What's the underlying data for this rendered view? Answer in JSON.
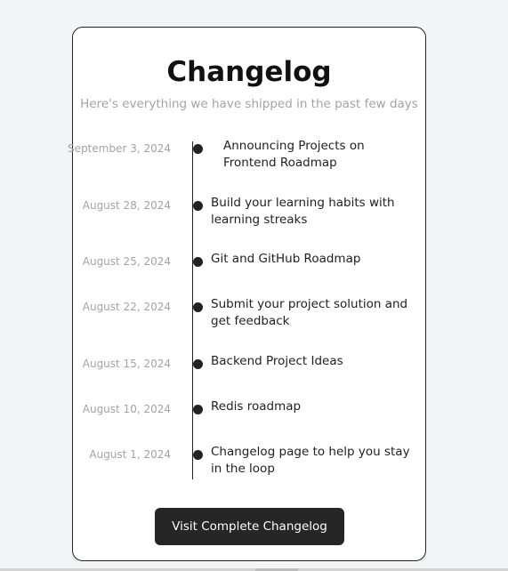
{
  "changelog": {
    "title": "Changelog",
    "subtitle": "Here's everything we have shipped in the past few days",
    "entries": [
      {
        "date": "September 3, 2024",
        "title": "Announcing Projects on Frontend Roadmap"
      },
      {
        "date": "August 28, 2024",
        "title": "Build your learning habits with learning streaks"
      },
      {
        "date": "August 25, 2024",
        "title": "Git and GitHub Roadmap"
      },
      {
        "date": "August 22, 2024",
        "title": "Submit your project solution and get feedback"
      },
      {
        "date": "August 15, 2024",
        "title": "Backend Project Ideas"
      },
      {
        "date": "August 10, 2024",
        "title": "Redis roadmap"
      },
      {
        "date": "August 1, 2024",
        "title": "Changelog page to help you stay in the loop"
      }
    ],
    "cta_label": "Visit Complete Changelog"
  },
  "colors": {
    "page_background": "#f3f4f6",
    "card_background": "#ffffff",
    "accent_dark": "#222222",
    "muted_text": "#a3a3a3"
  },
  "icons": {
    "timeline_marker": "timeline-dot-icon"
  }
}
